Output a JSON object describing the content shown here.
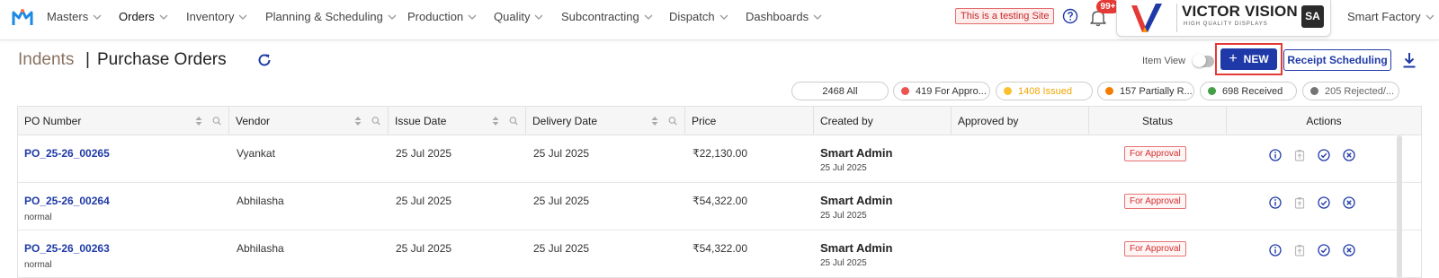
{
  "nav": {
    "menu": [
      {
        "label": "Masters",
        "active": false
      },
      {
        "label": "Orders",
        "active": true
      },
      {
        "label": "Inventory",
        "active": false
      },
      {
        "label": "Planning & Scheduling",
        "active": false
      },
      {
        "label": "Production",
        "active": false
      },
      {
        "label": "Quality",
        "active": false
      },
      {
        "label": "Subcontracting",
        "active": false
      },
      {
        "label": "Dispatch",
        "active": false
      },
      {
        "label": "Dashboards",
        "active": false
      }
    ],
    "testing_badge": "This is a testing Site",
    "notification_count": "99+",
    "brand_name": "VICTOR VISION",
    "brand_tagline": "HIGH QUALITY DISPLAYS",
    "avatar_initials": "SA",
    "factory": "Smart Factory"
  },
  "header": {
    "breadcrumb_parent": "Indents",
    "separator": "|",
    "title": "Purchase Orders",
    "item_view_label": "Item View",
    "item_view_on": false,
    "new_button": "NEW",
    "receipt_button": "Receipt Scheduling"
  },
  "filters": [
    {
      "label": "2468 All",
      "color": ""
    },
    {
      "label": "419 For Appro...",
      "color": "#ef5350"
    },
    {
      "label": "1408 Issued",
      "color": "#fbc02d"
    },
    {
      "label": "157 Partially R...",
      "color": "#f57c00"
    },
    {
      "label": "698 Received",
      "color": "#43a047"
    },
    {
      "label": "205 Rejected/...",
      "color": "#757575"
    }
  ],
  "table": {
    "columns": [
      "PO Number",
      "Vendor",
      "Issue Date",
      "Delivery Date",
      "Price",
      "Created by",
      "Approved by",
      "Status",
      "Actions"
    ],
    "rows": [
      {
        "po": "PO_25-26_00265",
        "tag": "",
        "vendor": "Vyankat",
        "issue_date": "25 Jul 2025",
        "delivery_date": "25 Jul 2025",
        "price": "₹22,130.00",
        "created_by": "Smart Admin",
        "created_date": "25 Jul 2025",
        "approved_by": "",
        "status": "For Approval"
      },
      {
        "po": "PO_25-26_00264",
        "tag": "normal",
        "vendor": "Abhilasha",
        "issue_date": "25 Jul 2025",
        "delivery_date": "25 Jul 2025",
        "price": "₹54,322.00",
        "created_by": "Smart Admin",
        "created_date": "25 Jul 2025",
        "approved_by": "",
        "status": "For Approval"
      },
      {
        "po": "PO_25-26_00263",
        "tag": "normal",
        "vendor": "Abhilasha",
        "issue_date": "25 Jul 2025",
        "delivery_date": "25 Jul 2025",
        "price": "₹54,322.00",
        "created_by": "Smart Admin",
        "created_date": "25 Jul 2025",
        "approved_by": "",
        "status": "For Approval"
      }
    ]
  },
  "colors": {
    "primary": "#1f3aa8",
    "status_red": "#d32f2f",
    "breadcrumb": "#8a7262"
  }
}
